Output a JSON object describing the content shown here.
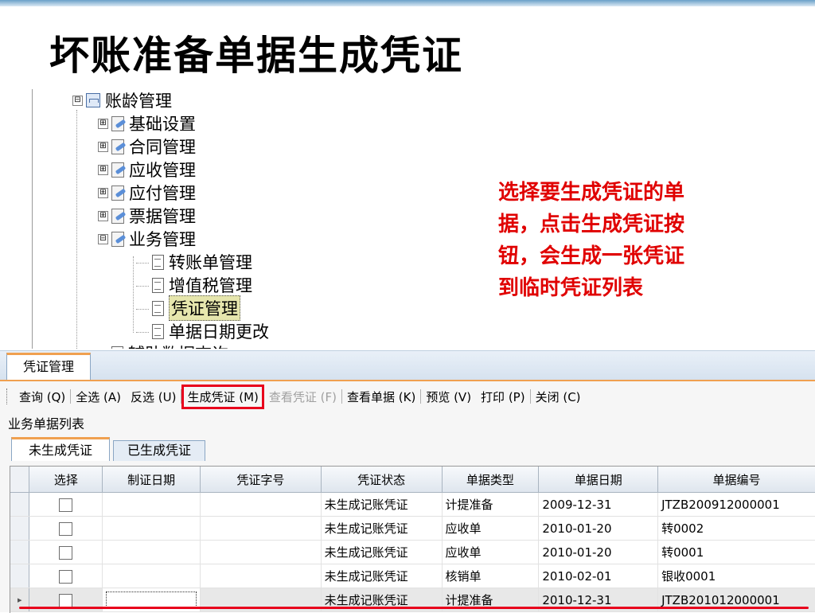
{
  "slide": {
    "title": "坏账准备单据生成凭证",
    "note_lines": [
      "选择要生成凭证的单",
      "据，点击生成凭证按",
      "钮，会生成一张凭证",
      "到临时凭证列表"
    ]
  },
  "tree": {
    "root": {
      "label": "账龄管理",
      "expander": "⊟",
      "icon": "org-chart-icon"
    },
    "children": [
      {
        "label": "基础设置",
        "expander": "⊞",
        "icon": "folder-icon"
      },
      {
        "label": "合同管理",
        "expander": "⊞",
        "icon": "folder-icon"
      },
      {
        "label": "应收管理",
        "expander": "⊞",
        "icon": "folder-icon"
      },
      {
        "label": "应付管理",
        "expander": "⊞",
        "icon": "folder-icon"
      },
      {
        "label": "票据管理",
        "expander": "⊞",
        "icon": "folder-icon"
      },
      {
        "label": "业务管理",
        "expander": "⊟",
        "icon": "folder-icon"
      }
    ],
    "business_children": [
      {
        "label": "转账单管理",
        "icon": "document-icon"
      },
      {
        "label": "增值税管理",
        "icon": "document-icon"
      },
      {
        "label": "凭证管理",
        "icon": "document-icon",
        "selected": true
      },
      {
        "label": "单据日期更改",
        "icon": "document-icon"
      }
    ],
    "partial_item": "辅助数据查询"
  },
  "app": {
    "tab_title": "凭证管理",
    "toolbar": [
      {
        "label": "查询 (Q)",
        "enabled": true
      },
      {
        "label": "全选 (A)",
        "enabled": true
      },
      {
        "label": "反选 (U)",
        "enabled": true
      },
      {
        "label": "生成凭证 (M)",
        "enabled": true,
        "highlighted": true
      },
      {
        "label": "查看凭证 (F)",
        "enabled": false
      },
      {
        "label": "查看单据 (K)",
        "enabled": true
      },
      {
        "label": "预览 (V)",
        "enabled": true
      },
      {
        "label": "打印 (P)",
        "enabled": true
      },
      {
        "label": "关闭 (C)",
        "enabled": true
      }
    ],
    "section_label": "业务单据列表",
    "subtabs": {
      "active": "未生成凭证",
      "inactive": "已生成凭证"
    },
    "grid": {
      "columns": [
        "选择",
        "制证日期",
        "凭证字号",
        "凭证状态",
        "单据类型",
        "单据日期",
        "单据编号"
      ],
      "rows": [
        {
          "checked": false,
          "voucher_date": "",
          "voucher_no": "",
          "status": "未生成记账凭证",
          "doc_type": "计提准备",
          "doc_date": "2009-12-31",
          "doc_no": "JTZB200912000001"
        },
        {
          "checked": false,
          "voucher_date": "",
          "voucher_no": "",
          "status": "未生成记账凭证",
          "doc_type": "应收单",
          "doc_date": "2010-01-20",
          "doc_no": "转0002"
        },
        {
          "checked": false,
          "voucher_date": "",
          "voucher_no": "",
          "status": "未生成记账凭证",
          "doc_type": "应收单",
          "doc_date": "2010-01-20",
          "doc_no": "转0001"
        },
        {
          "checked": false,
          "voucher_date": "",
          "voucher_no": "",
          "status": "未生成记账凭证",
          "doc_type": "核销单",
          "doc_date": "2010-02-01",
          "doc_no": "银收0001"
        },
        {
          "checked": false,
          "voucher_date": "",
          "voucher_no": "",
          "status": "未生成记账凭证",
          "doc_type": "计提准备",
          "doc_date": "2010-12-31",
          "doc_no": "JTZB201012000001",
          "current": true,
          "row_marker": "▸"
        }
      ]
    }
  },
  "colors": {
    "annotation_red": "#e8001c",
    "note_red": "#e00000",
    "tab_accent": "#f0a050"
  }
}
